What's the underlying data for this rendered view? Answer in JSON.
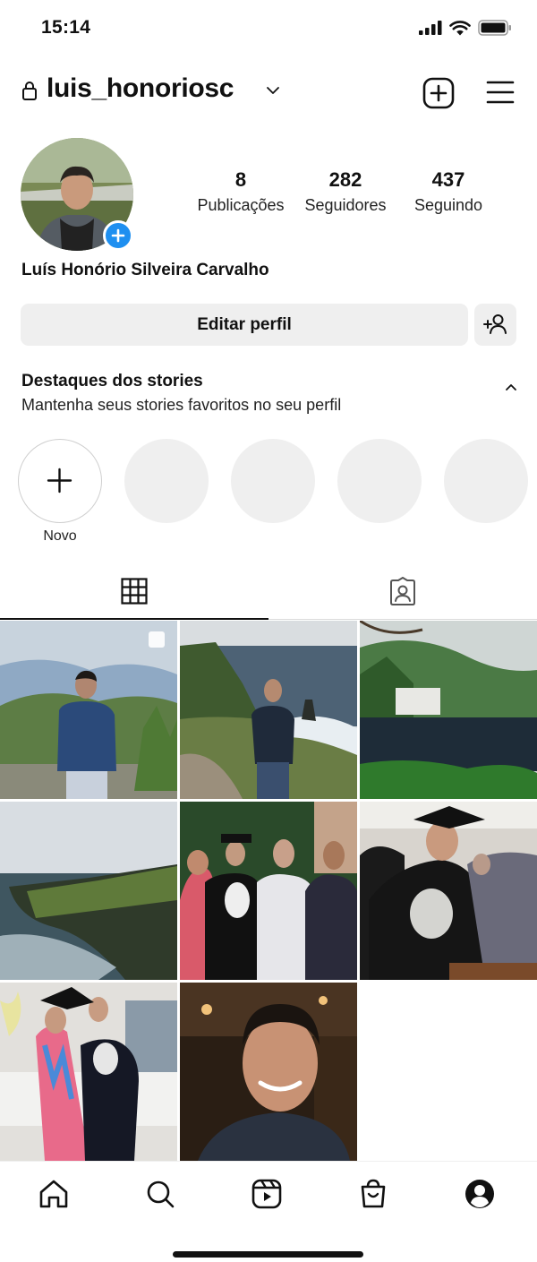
{
  "status_bar": {
    "time": "15:14"
  },
  "header": {
    "username": "luis_honoriosc"
  },
  "profile": {
    "full_name": "Luís Honório Silveira Carvalho",
    "stats": [
      {
        "value": "8",
        "label": "Publicações"
      },
      {
        "value": "282",
        "label": "Seguidores"
      },
      {
        "value": "437",
        "label": "Seguindo"
      }
    ],
    "edit_button": "Editar perfil"
  },
  "highlights": {
    "title": "Destaques dos stories",
    "subtitle": "Mantenha seus stories favoritos no seu perfil",
    "new_label": "Novo"
  },
  "tabs": [
    {
      "icon": "grid-icon",
      "active": true
    },
    {
      "icon": "tagged-icon",
      "active": false
    }
  ],
  "posts": [
    {
      "scene": "man in blue hoodie on mountain overlook",
      "multi": true
    },
    {
      "scene": "man on cliff path by the sea",
      "multi": false
    },
    {
      "scene": "lake with castle and green hills",
      "multi": false
    },
    {
      "scene": "sea cliffs under cloudy sky",
      "multi": false
    },
    {
      "scene": "graduation family photo",
      "multi": false
    },
    {
      "scene": "graduate in cap and gown signing",
      "multi": false
    },
    {
      "scene": "graduate with woman in floral dress",
      "multi": false
    },
    {
      "scene": "selfie in restaurant",
      "multi": false
    }
  ],
  "bottom_nav": [
    "home-icon",
    "search-icon",
    "reels-icon",
    "shop-icon",
    "profile-icon"
  ],
  "colors": {
    "accent_blue": "#1e8ff0",
    "button_gray": "#efefef"
  }
}
